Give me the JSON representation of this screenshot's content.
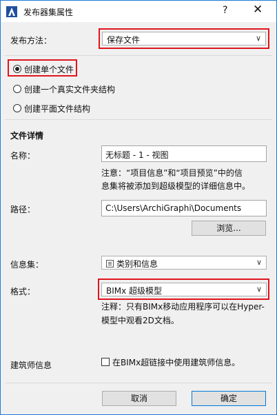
{
  "window": {
    "title": "发布器集属性",
    "help": "?",
    "close": "✕"
  },
  "publish_method": {
    "label": "发布方法：",
    "value": "保存文件"
  },
  "radios": [
    {
      "label": "创建单个文件",
      "selected": true
    },
    {
      "label": "创建一个真实文件夹结构",
      "selected": false
    },
    {
      "label": "创建平面文件结构",
      "selected": false
    }
  ],
  "file_details": {
    "heading": "文件详情",
    "name_label": "名称：",
    "name_value": "无标题 - 1 - 视图",
    "note_line1": "注意：“项目信息”和“项目预览”中的信",
    "note_line2": "息集将被添加到超级模型的详细信息中。",
    "path_label": "路径：",
    "path_value": "C:\\Users\\ArchiGraphi\\Documents",
    "browse_button": "浏览..."
  },
  "info_set": {
    "label": "信息集：",
    "value": "类别和信息",
    "icon": "list-icon"
  },
  "format": {
    "label": "格式：",
    "value": "BIMx 超级模型",
    "note_line1": "注释：只有BIMx移动应用程序可以在Hyper-",
    "note_line2": "模型中观看2D文档。"
  },
  "architect": {
    "label": "建筑师信息",
    "checkbox_label": "在BIMx超链接中使用建筑师信息。",
    "checked": false
  },
  "buttons": {
    "cancel": "取消",
    "ok": "确定"
  },
  "colors": {
    "highlight": "#e0141c",
    "window_border": "#1e7bd6",
    "primary_button_border": "#0078d7"
  }
}
